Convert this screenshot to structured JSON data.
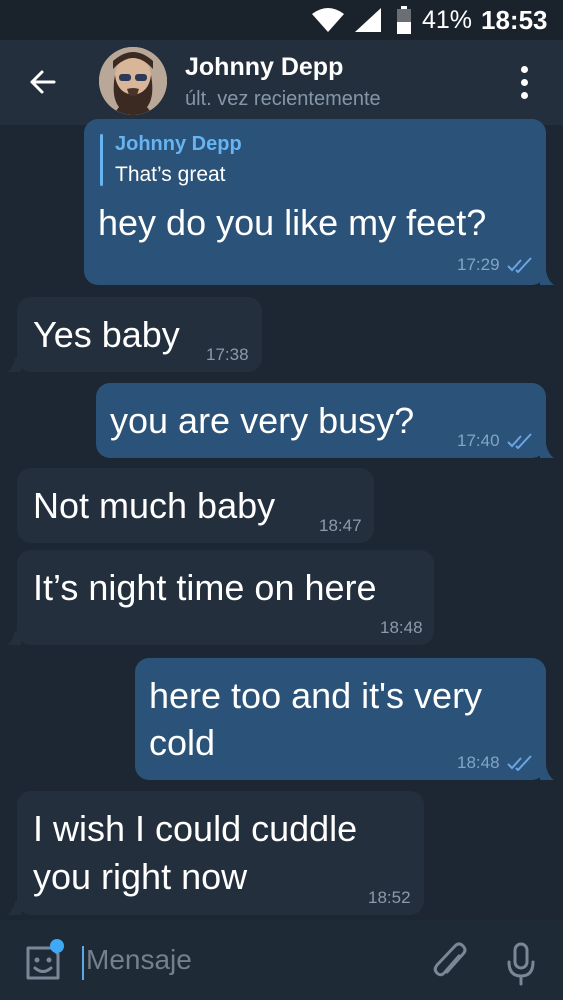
{
  "status_bar": {
    "battery_percent": "41%",
    "time": "18:53"
  },
  "header": {
    "contact_name": "Johnny Depp",
    "contact_status": "últ. vez recientemente"
  },
  "messages": [
    {
      "direction": "out",
      "reply": {
        "name": "Johnny Depp",
        "text": "That’s great"
      },
      "text": "hey do you like my feet?",
      "time": "17:29",
      "read": true
    },
    {
      "direction": "in",
      "text": "Yes baby",
      "time": "17:38"
    },
    {
      "direction": "out",
      "text": "you are very busy?",
      "time": "17:40",
      "read": true
    },
    {
      "direction": "in",
      "text": "Not much baby",
      "time": "18:47"
    },
    {
      "direction": "in",
      "text": "It’s night time on here",
      "time": "18:48"
    },
    {
      "direction": "out",
      "text_lines": [
        "here too and it's very",
        "cold"
      ],
      "time": "18:48",
      "read": true
    },
    {
      "direction": "in",
      "text_lines": [
        "I wish I could cuddle",
        "you right now"
      ],
      "time": "18:52"
    }
  ],
  "input": {
    "placeholder": "Mensaje"
  },
  "colors": {
    "background": "#1d2733",
    "header": "#242f3d",
    "outgoing_bubble": "#2b5278",
    "incoming_bubble": "#232f3d",
    "accent": "#66b4f2"
  },
  "icons": [
    "back-arrow-icon",
    "more-vertical-icon",
    "wifi-icon",
    "signal-icon",
    "battery-icon",
    "emoji-sticker-icon",
    "attach-icon",
    "microphone-icon",
    "double-check-icon"
  ]
}
